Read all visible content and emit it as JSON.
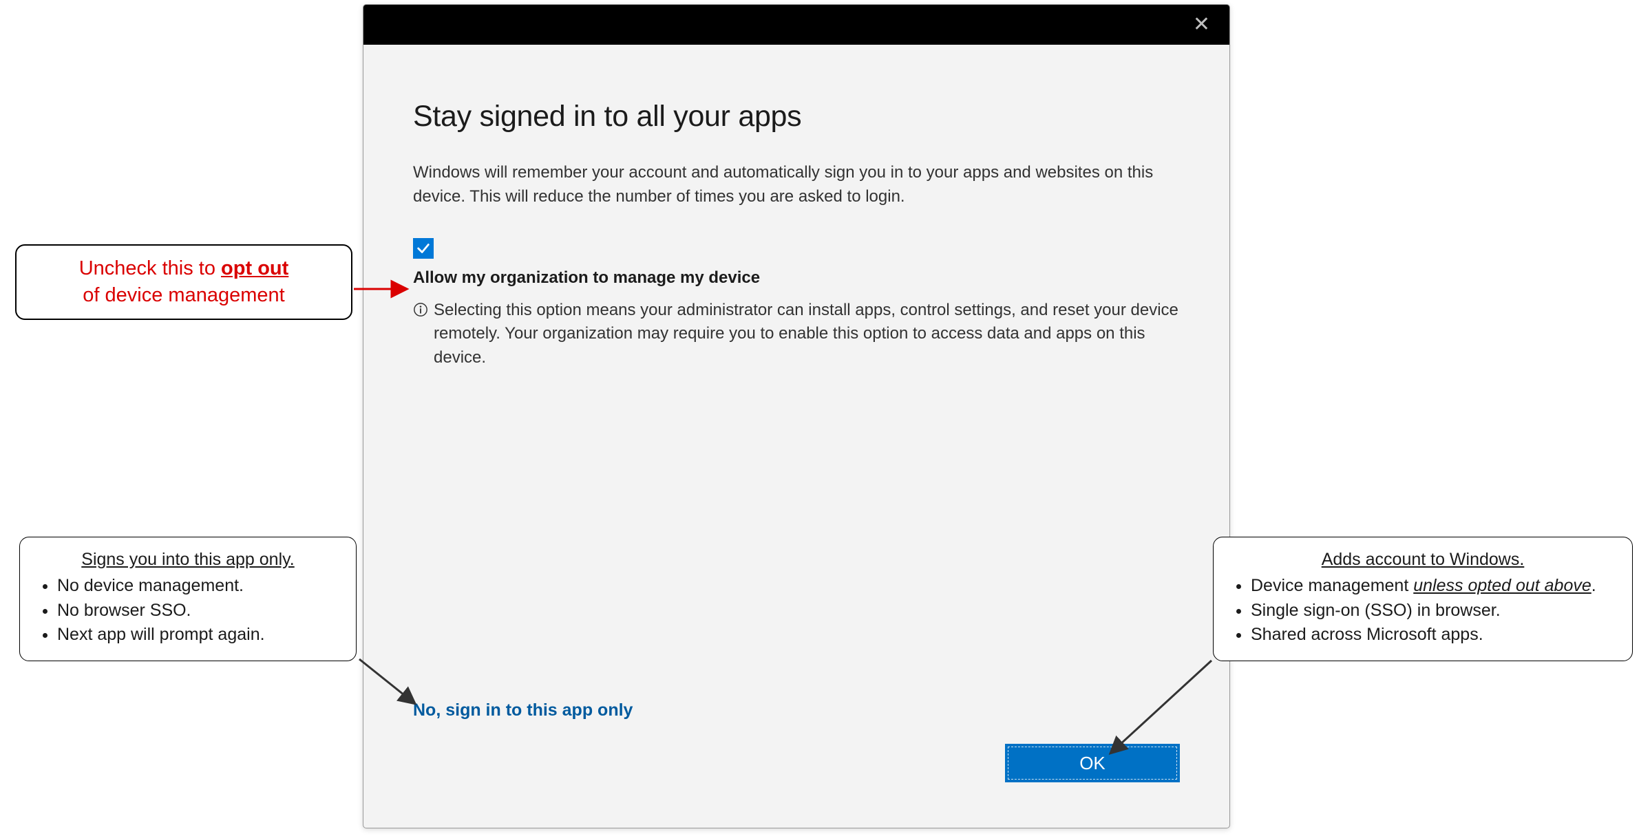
{
  "dialog": {
    "title": "Stay signed in to all your apps",
    "description": "Windows will remember your account and automatically sign you in to your apps and websites on this device. This will reduce the number of times you are asked to login.",
    "checkbox_label": "Allow my organization to manage my device",
    "checkbox_checked": true,
    "info_text": "Selecting this option means your administrator can install apps, control settings, and reset your device remotely. Your organization may require you to enable this option to access data and apps on this device.",
    "link_app_only": "No, sign in to this app only",
    "ok_button": "OK"
  },
  "annotations": {
    "opt_out": {
      "line1_prefix": "Uncheck this to ",
      "line1_emph": "opt out",
      "line2": "of device management"
    },
    "app_only": {
      "heading": "Signs you into this app only.",
      "bullets": [
        "No device management.",
        "No browser SSO.",
        "Next app will prompt again."
      ]
    },
    "ok_note": {
      "heading": "Adds account to Windows.",
      "bullet1_prefix": "Device management ",
      "bullet1_emph": "unless opted out above",
      "bullet1_suffix": ".",
      "bullets_rest": [
        "Single sign-on (SSO) in browser.",
        "Shared across Microsoft apps."
      ]
    }
  }
}
